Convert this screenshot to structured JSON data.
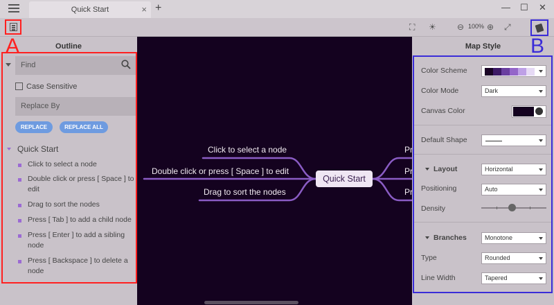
{
  "titlebar": {
    "tab_title": "Quick Start",
    "tab_close": "×",
    "new_tab": "+",
    "minimize": "—",
    "maximize": "☐",
    "close": "✕"
  },
  "toolbar": {
    "zoom_level": "100%"
  },
  "markers": {
    "left": "A",
    "right": "B"
  },
  "outline": {
    "title": "Outline",
    "find_placeholder": "Find",
    "case_sensitive": "Case Sensitive",
    "replace_placeholder": "Replace By",
    "replace_btn": "REPLACE",
    "replace_all_btn": "REPLACE ALL",
    "root": "Quick Start",
    "items": [
      "Click to select a node",
      "Double click or press [ Space ] to edit",
      "Drag to sort the nodes",
      "Press [ Tab ] to add a child node",
      "Press [ Enter ] to add a sibling node",
      "Press [ Backspace ] to delete a node"
    ]
  },
  "canvas": {
    "root": "Quick Start",
    "left_nodes": [
      "Click to select a node",
      "Double click or press [ Space ] to edit",
      "Drag to sort the nodes"
    ],
    "right_nodes": [
      "Pr",
      "Pr",
      "Pr"
    ],
    "background": "#14021f",
    "branch_color": "#8a5cc4"
  },
  "map_style": {
    "title": "Map Style",
    "color_scheme_label": "Color Scheme",
    "color_scheme_swatches": [
      "#1a0526",
      "#3d1a66",
      "#6a3fa0",
      "#9466c9",
      "#bea0e6",
      "#e6daf5"
    ],
    "color_mode_label": "Color Mode",
    "color_mode": "Dark",
    "canvas_color_label": "Canvas Color",
    "default_shape_label": "Default Shape",
    "layout_label": "Layout",
    "layout": "Horizontal",
    "positioning_label": "Positioning",
    "positioning": "Auto",
    "density_label": "Density",
    "density_value": 0.47,
    "branches_label": "Branches",
    "branches": "Monotone",
    "type_label": "Type",
    "type": "Rounded",
    "line_width_label": "Line Width",
    "line_width": "Tapered"
  }
}
